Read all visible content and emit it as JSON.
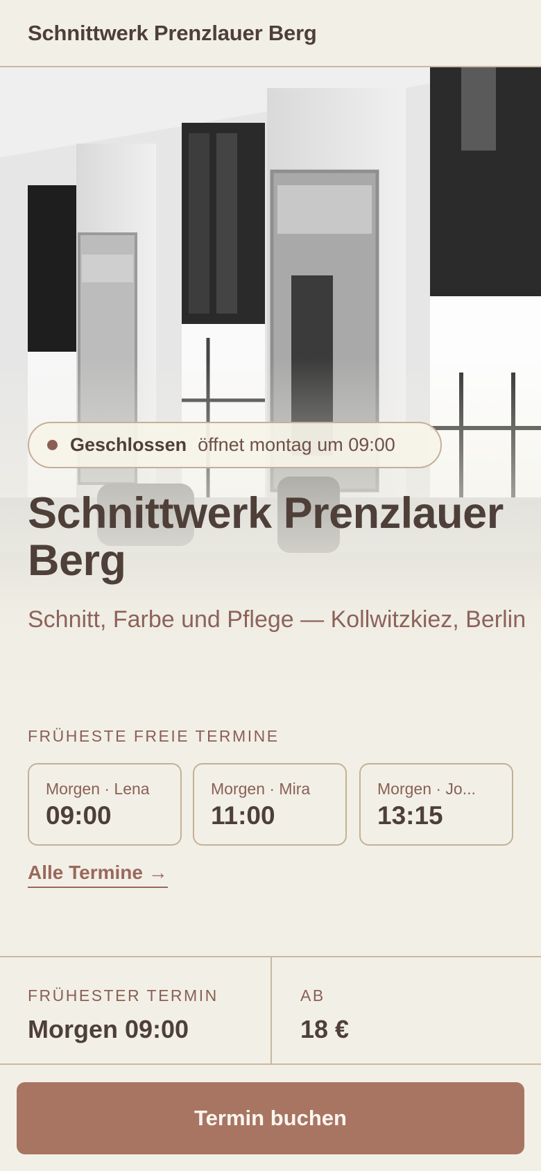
{
  "header": {
    "title": "Schnittwerk Prenzlauer Berg"
  },
  "hero": {
    "image_alt": "Salon-Innenraum mit Spiegeln und Fenstern",
    "status": {
      "label": "Geschlossen",
      "detail": "öffnet montag um 09:00"
    },
    "title": "Schnittwerk Prenzlauer Berg",
    "subtitle": "Schnitt, Farbe und Pflege — Kollwitzkiez, Berlin"
  },
  "slots_section": {
    "label": "FRÜHESTE FREIE TERMINE",
    "slots": [
      {
        "meta": "Morgen · Lena",
        "time": "09:00"
      },
      {
        "meta": "Morgen · Mira",
        "time": "11:00"
      },
      {
        "meta": "Morgen · Jo...",
        "time": "13:15"
      }
    ],
    "all_link": "Alle Termine →"
  },
  "summary": {
    "earliest_label": "FRÜHESTER TERMIN",
    "earliest_value": "Morgen 09:00",
    "price_label": "AB",
    "price_value": "18 €"
  },
  "cta": {
    "label": "Termin buchen"
  },
  "colors": {
    "background": "#f2f0e6",
    "text": "#4e3f39",
    "accent": "#a87563",
    "muted": "#8a5f56",
    "border": "#c4b096"
  }
}
